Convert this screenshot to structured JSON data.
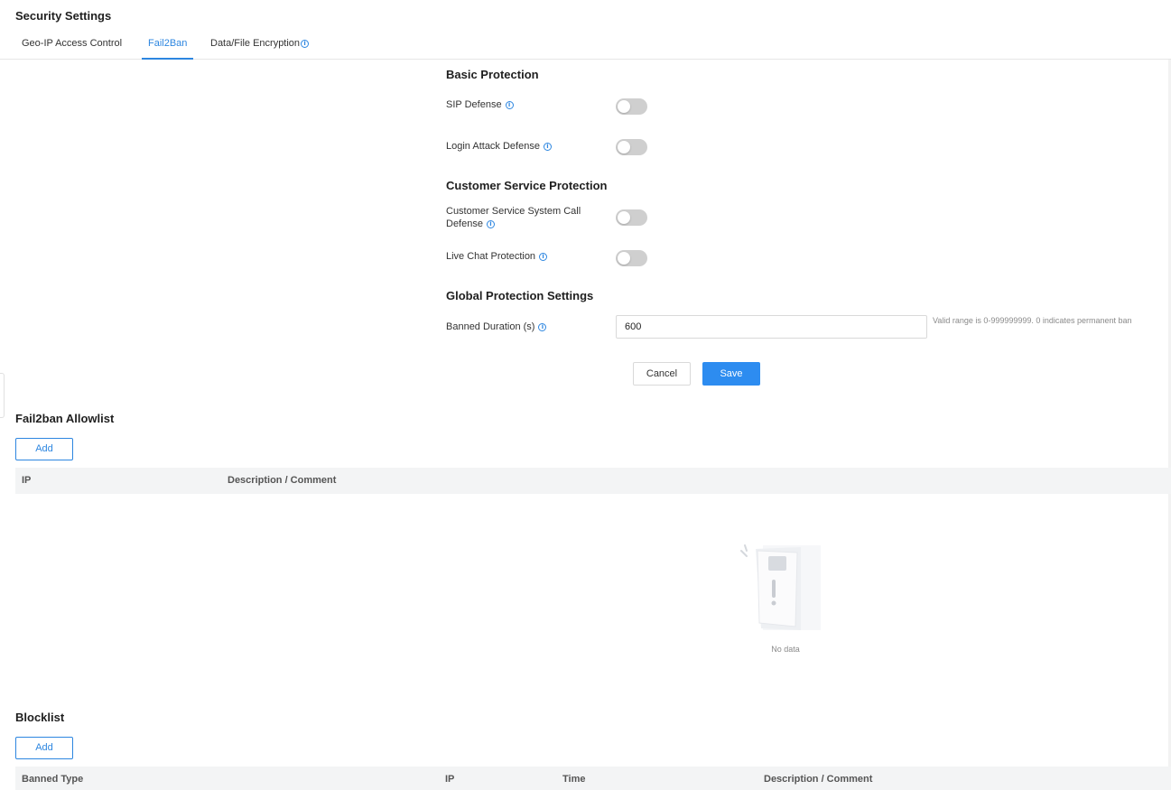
{
  "page": {
    "title": "Security Settings"
  },
  "tabs": [
    {
      "label": "Geo-IP Access Control",
      "active": false
    },
    {
      "label": "Fail2Ban",
      "active": true
    },
    {
      "label": "Data/File Encryption",
      "active": false,
      "info": "i"
    }
  ],
  "basic_protection": {
    "title": "Basic Protection",
    "sip_defense": {
      "label": "SIP Defense",
      "enabled": false
    },
    "login_attack_defense": {
      "label": "Login Attack Defense",
      "enabled": false
    }
  },
  "customer_service_protection": {
    "title": "Customer Service Protection",
    "call_defense": {
      "label_line1": "Customer Service System Call",
      "label_line2": "Defense",
      "enabled": false
    },
    "live_chat": {
      "label": "Live Chat Protection",
      "enabled": false
    }
  },
  "global_protection": {
    "title": "Global Protection Settings",
    "banned_duration": {
      "label": "Banned Duration (s)",
      "value": "600",
      "hint": "Valid range is 0-999999999. 0 indicates permanent ban"
    }
  },
  "form_actions": {
    "cancel": "Cancel",
    "save": "Save"
  },
  "allowlist": {
    "title": "Fail2ban Allowlist",
    "add_label": "Add",
    "columns": [
      "IP",
      "Description / Comment"
    ],
    "empty_text": "No data"
  },
  "blocklist": {
    "title": "Blocklist",
    "add_label": "Add",
    "columns": [
      "Banned Type",
      "IP",
      "Time",
      "Description / Comment"
    ]
  },
  "colors": {
    "accent": "#2d86e0",
    "primary_button": "#2d8cf0",
    "toggle_off": "#cfcfcf",
    "table_header_bg": "#f3f4f5"
  },
  "icons": {
    "info": "info-circle-icon",
    "empty": "empty-document-icon"
  }
}
